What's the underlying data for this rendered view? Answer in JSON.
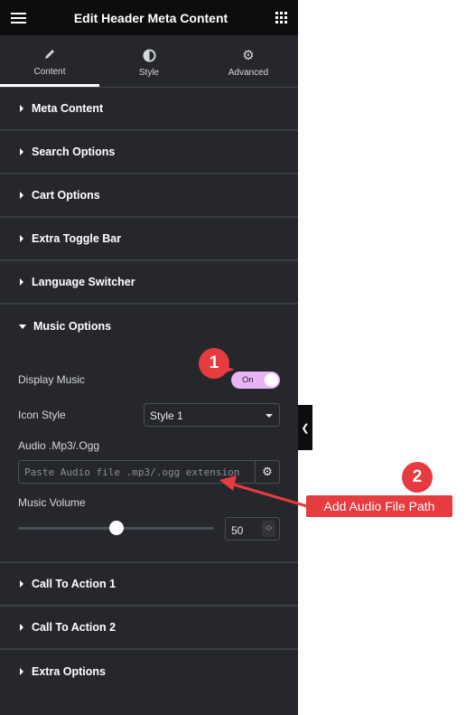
{
  "header": {
    "title": "Edit Header Meta Content",
    "menu_icon": "hamburger-icon",
    "apps_icon": "grid-icon"
  },
  "tabs": [
    {
      "label": "Content",
      "icon": "pencil-icon",
      "active": true
    },
    {
      "label": "Style",
      "icon": "contrast-icon",
      "active": false
    },
    {
      "label": "Advanced",
      "icon": "gear-icon",
      "active": false
    }
  ],
  "sections_before": [
    {
      "label": "Meta Content"
    },
    {
      "label": "Search Options"
    },
    {
      "label": "Cart Options"
    },
    {
      "label": "Extra Toggle Bar"
    },
    {
      "label": "Language Switcher"
    }
  ],
  "music": {
    "label": "Music Options",
    "display_music": {
      "label": "Display Music",
      "value": "On",
      "enabled": true
    },
    "icon_style": {
      "label": "Icon Style",
      "value": "Style 1"
    },
    "audio": {
      "label": "Audio .Mp3/.Ogg",
      "value": "",
      "placeholder": "Paste Audio file .mp3/.ogg extension"
    },
    "volume": {
      "label": "Music Volume",
      "value": "50",
      "percent": 50
    }
  },
  "sections_after": [
    {
      "label": "Call To Action 1"
    },
    {
      "label": "Call To Action 2"
    },
    {
      "label": "Extra Options"
    }
  ],
  "annotations": {
    "badge1": "1",
    "badge2": "2",
    "callout": "Add Audio File Path",
    "color": "#e63b3f"
  },
  "colors": {
    "panel_bg": "#26272c",
    "topbar_bg": "#0c0d0e",
    "toggle_on": "#e9b4f4"
  }
}
